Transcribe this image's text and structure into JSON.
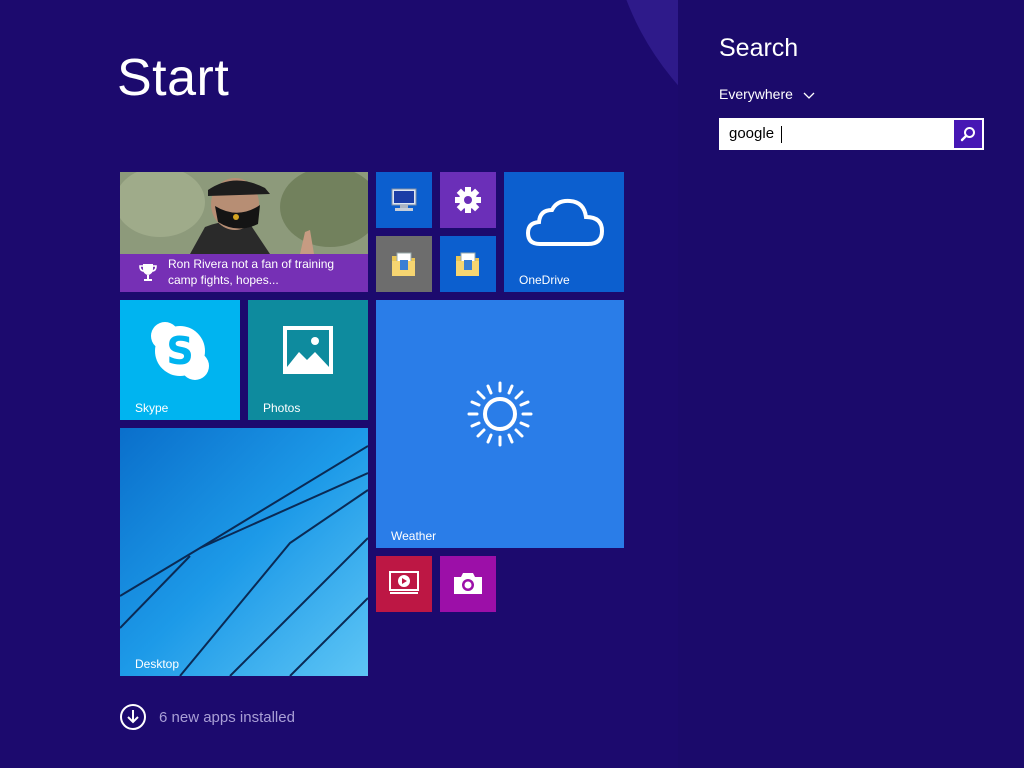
{
  "start": {
    "title": "Start",
    "new_apps_text": "6 new apps installed"
  },
  "tiles": {
    "news": {
      "headline": "Ron Rivera not a fan of training camp fights, hopes...",
      "icon": "trophy-icon"
    },
    "computer": {
      "icon": "computer-icon"
    },
    "settings": {
      "icon": "gear-icon"
    },
    "onedrive": {
      "label": "OneDrive",
      "icon": "cloud-icon"
    },
    "file_explorer_1": {
      "icon": "folder-icon"
    },
    "file_explorer_2": {
      "icon": "folder-icon"
    },
    "skype": {
      "label": "Skype",
      "icon": "skype-icon"
    },
    "photos": {
      "label": "Photos",
      "icon": "picture-icon"
    },
    "weather": {
      "label": "Weather",
      "icon": "sun-icon"
    },
    "desktop": {
      "label": "Desktop"
    },
    "video": {
      "icon": "video-play-icon"
    },
    "camera": {
      "icon": "camera-icon"
    }
  },
  "search": {
    "title": "Search",
    "scope": "Everywhere",
    "query": "google"
  },
  "colors": {
    "background": "#1c0a6e",
    "tile_blue": "#0c5fcf",
    "tile_purple": "#6b2fb8",
    "tile_cyan": "#00b4f0",
    "tile_teal": "#0e8b9e",
    "tile_weather": "#2a7de8",
    "tile_red": "#bd1744",
    "tile_magenta": "#9c0fa8",
    "accent": "#4617b4"
  }
}
